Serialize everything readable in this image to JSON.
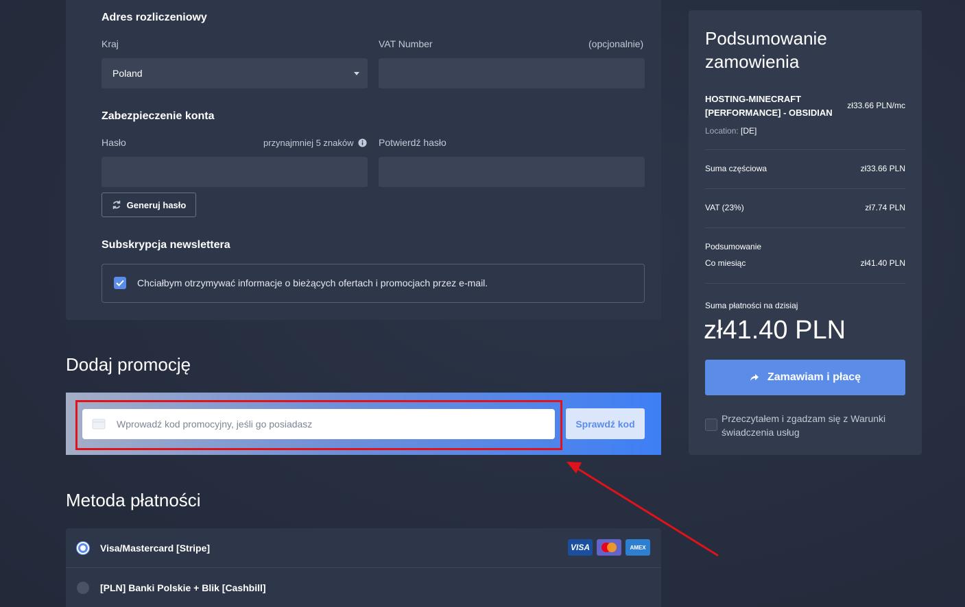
{
  "billing": {
    "title": "Adres rozliczeniowy",
    "country_label": "Kraj",
    "country_value": "Poland",
    "vat_label": "VAT Number",
    "vat_optional": "(opcjonalnie)",
    "vat_value": ""
  },
  "security": {
    "title": "Zabezpieczenie konta",
    "password_label": "Hasło",
    "password_hint": "przynajmniej 5 znaków",
    "confirm_label": "Potwierdź hasło",
    "generate_label": "Generuj hasło"
  },
  "newsletter": {
    "title": "Subskrypcja newslettera",
    "checkbox_label": "Chciałbym otrzymywać informacje o bieżących ofertach i promocjach przez e-mail.",
    "checked": true
  },
  "promo": {
    "title": "Dodaj promocję",
    "placeholder": "Wprowadź kod promocyjny, jeśli go posiadasz",
    "check_button": "Sprawdź kod"
  },
  "payment": {
    "title": "Metoda płatności",
    "methods": [
      {
        "label": "Visa/Mastercard [Stripe]",
        "selected": true
      },
      {
        "label": "[PLN] Banki Polskie + Blik [Cashbill]",
        "selected": false
      }
    ],
    "logos": [
      "VISA",
      "mastercard",
      "AMEX"
    ]
  },
  "summary": {
    "title_line1": "Podsumowanie",
    "title_line2": "zamowienia",
    "product_line1": "HOSTING-MINECRAFT",
    "product_line2": "[PERFORMANCE] - OBSIDIAN",
    "product_price": "zł33.66 PLN/mc",
    "location_label": "Location:",
    "location_value": "[DE]",
    "subtotal_label": "Suma częściowa",
    "subtotal_value": "zł33.66 PLN",
    "vat_label": "VAT (23%)",
    "vat_value": "zł7.74 PLN",
    "totals_label": "Podsumowanie",
    "monthly_label": "Co miesiąc",
    "monthly_value": "zł41.40 PLN",
    "due_today_label": "Suma płatności na dzisiaj",
    "due_today_value": "zł41.40 PLN",
    "order_button": "Zamawiam i płacę",
    "terms_prefix": "Przeczytałem i zgadzam się z ",
    "terms_link_1": "Warunki",
    "terms_link_2": "świadczenia usług"
  },
  "colors": {
    "accent": "#5b8de8",
    "highlight": "#e0121a"
  }
}
